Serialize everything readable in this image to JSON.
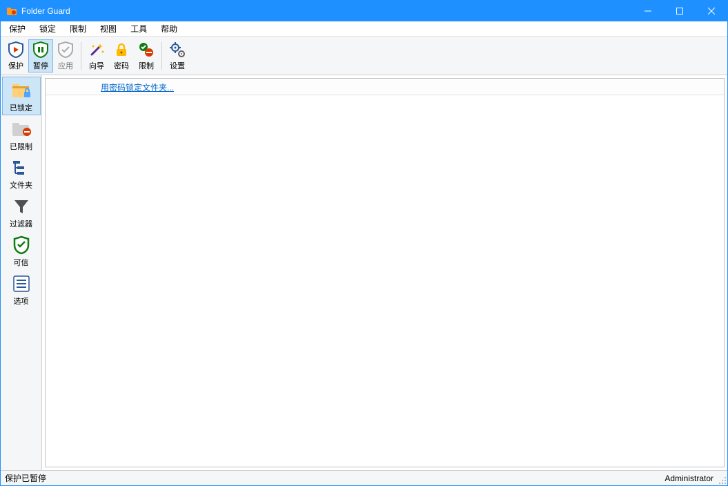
{
  "window": {
    "title": "Folder Guard"
  },
  "menu": {
    "items": [
      "保护",
      "锁定",
      "限制",
      "视图",
      "工具",
      "帮助"
    ]
  },
  "toolbar": {
    "protect": "保护",
    "pause": "暂停",
    "apply": "应用",
    "wizard": "向导",
    "password": "密码",
    "restrict": "限制",
    "settings": "设置"
  },
  "sidebar": {
    "locked": "已锁定",
    "restricted": "已限制",
    "folders": "文件夹",
    "filters": "过滤器",
    "trusted": "可信",
    "options": "选项"
  },
  "content": {
    "lock_link": "用密码锁定文件夹..."
  },
  "statusbar": {
    "left": "保护已暂停",
    "right": "Administrator"
  }
}
